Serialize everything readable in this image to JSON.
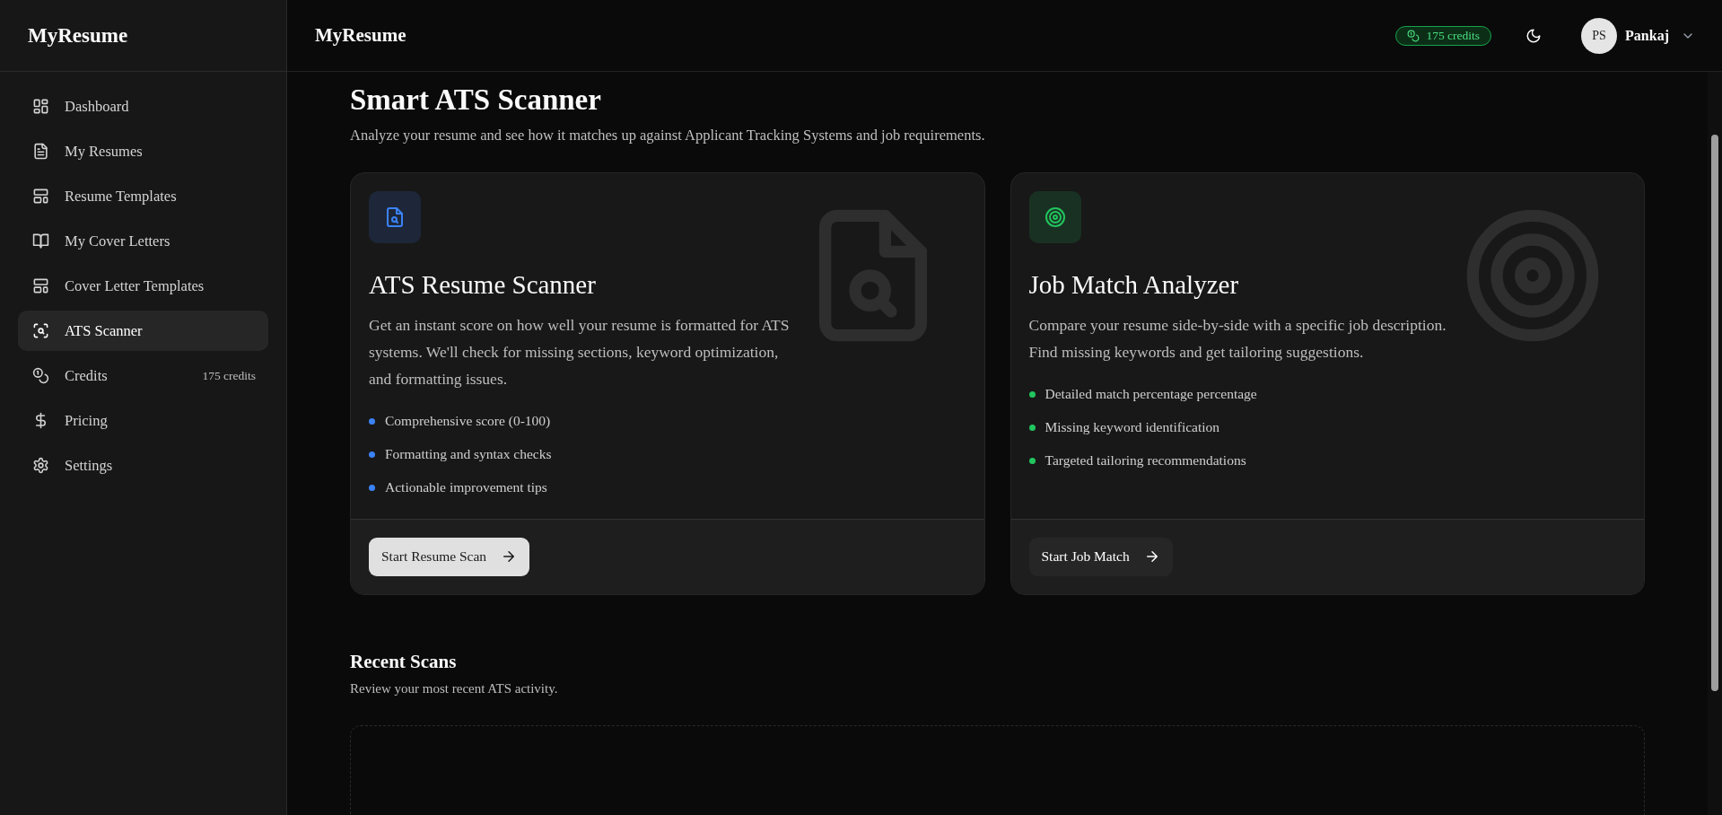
{
  "sidebar": {
    "logo": "MyResume",
    "items": [
      {
        "kind": "dashboard",
        "label": "Dashboard",
        "selected": false
      },
      {
        "kind": "resumes",
        "label": "My Resumes",
        "selected": false
      },
      {
        "kind": "templates",
        "label": "Resume Templates",
        "selected": false
      },
      {
        "kind": "letters",
        "label": "My Cover Letters",
        "selected": false
      },
      {
        "kind": "templates",
        "label": "Cover Letter Templates",
        "selected": false
      },
      {
        "kind": "scanner",
        "label": "ATS Scanner",
        "selected": true
      },
      {
        "kind": "credits",
        "label": "Credits",
        "selected": false,
        "badge": "175 credits"
      },
      {
        "kind": "pricing",
        "label": "Pricing",
        "selected": false
      },
      {
        "kind": "settings",
        "label": "Settings",
        "selected": false
      }
    ]
  },
  "header": {
    "title": "MyResume",
    "credits": "175 credits",
    "user": {
      "initials": "PS",
      "name": "Pankaj"
    }
  },
  "page": {
    "title": "Smart ATS Scanner",
    "subtitle": "Analyze your resume and see how it matches up against Applicant Tracking Systems and job requirements."
  },
  "cards": [
    {
      "kind": "resume",
      "color": "#3b82f6",
      "title": "ATS Resume Scanner",
      "description": "Get an instant score on how well your resume is formatted for ATS systems. We'll check for missing sections, keyword optimization, and formatting issues.",
      "features": [
        "Comprehensive score (0-100)",
        "Formatting and syntax checks",
        "Actionable improvement tips"
      ],
      "button": {
        "label": "Start Resume Scan",
        "primary": true
      }
    },
    {
      "kind": "match",
      "color": "#22c55e",
      "title": "Job Match Analyzer",
      "description": "Compare your resume side-by-side with a specific job description. Find missing keywords and get tailoring suggestions.",
      "features": [
        "Detailed match percentage percentage",
        "Missing keyword identification",
        "Targeted tailoring recommendations"
      ],
      "button": {
        "label": "Start Job Match",
        "primary": false
      }
    }
  ],
  "recent": {
    "title": "Recent Scans",
    "subtitle": "Review your most recent ATS activity."
  }
}
